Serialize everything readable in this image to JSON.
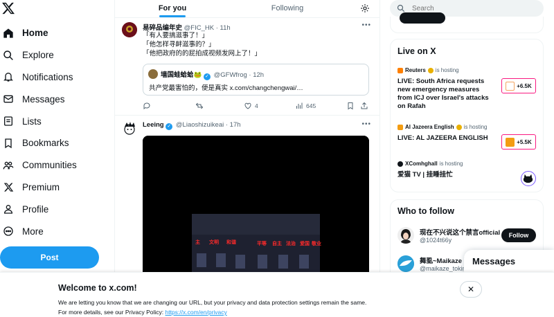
{
  "sidebar": {
    "items": [
      {
        "label": "Home",
        "icon": "home-icon",
        "active": true
      },
      {
        "label": "Explore",
        "icon": "search-icon"
      },
      {
        "label": "Notifications",
        "icon": "bell-icon"
      },
      {
        "label": "Messages",
        "icon": "envelope-icon"
      },
      {
        "label": "Lists",
        "icon": "list-icon"
      },
      {
        "label": "Bookmarks",
        "icon": "bookmark-icon"
      },
      {
        "label": "Communities",
        "icon": "people-icon"
      },
      {
        "label": "Premium",
        "icon": "x-logo-icon"
      },
      {
        "label": "Profile",
        "icon": "person-icon"
      },
      {
        "label": "More",
        "icon": "more-circle-icon"
      }
    ],
    "post_label": "Post"
  },
  "tabs": [
    {
      "label": "For you",
      "active": true
    },
    {
      "label": "Following",
      "active": false
    }
  ],
  "tweets": [
    {
      "name": "易碎品编年史",
      "handle": "@FIC_HK · 11h",
      "lines": [
        "「有人要搞滋事了！」",
        "「他怎样寻衅滋事的？」",
        "「他把政府的的屁拍成视频发网上了！」"
      ],
      "quote": {
        "name": "墙国蛙蛤蛤🐸",
        "handle": "@GFWfrog · 12h",
        "text": "共产党最害怕的，便是真实 x.com/changchengwai/…"
      },
      "actions": {
        "reply": "",
        "retweet": "",
        "like": "4",
        "views": "645"
      }
    },
    {
      "name": "Leeing",
      "handle": "@Liaoshizuikeai · 17h",
      "media_signs": [
        "主",
        "文明",
        "和谐",
        "平等",
        "自主",
        "法治",
        "爱国",
        "敬业"
      ]
    }
  ],
  "search": {
    "placeholder": "Search"
  },
  "live": {
    "title": "Live on X",
    "hosting_text": "is hosting",
    "items": [
      {
        "host": "Reuters",
        "title": "LIVE: South Africa requests new emergency measures from ICJ over Israel's attacks on Rafah",
        "count": "+6.5K"
      },
      {
        "host": "Al Jazeera English",
        "title": "LIVE: AL JAZEERA ENGLISH",
        "count": "+5.5K"
      },
      {
        "host": "XComhghall",
        "title": "爱猫 TV | 挂睡挂忙",
        "count": ""
      }
    ]
  },
  "who_to_follow": {
    "title": "Who to follow",
    "follow_label": "Follow",
    "accounts": [
      {
        "name": "现在不兴说这个禁言official",
        "handle": "@1024t66y"
      },
      {
        "name": "舞虱~Maikaze 睡",
        "handle": "@maikaze_tokin"
      }
    ]
  },
  "messages_dock": {
    "label": "Messages"
  },
  "banner": {
    "title": "Welcome to x.com!",
    "line1": "We are letting you know that we are changing our URL, but your privacy and data protection settings remain the same.",
    "line2_prefix": "For more details, see our Privacy Policy: ",
    "link": "https://x.com/en/privacy",
    "close": "✕"
  },
  "colors": {
    "accent": "#1d9bf0",
    "live_border": "#f91880",
    "text": "#0f1419",
    "muted": "#536471"
  }
}
